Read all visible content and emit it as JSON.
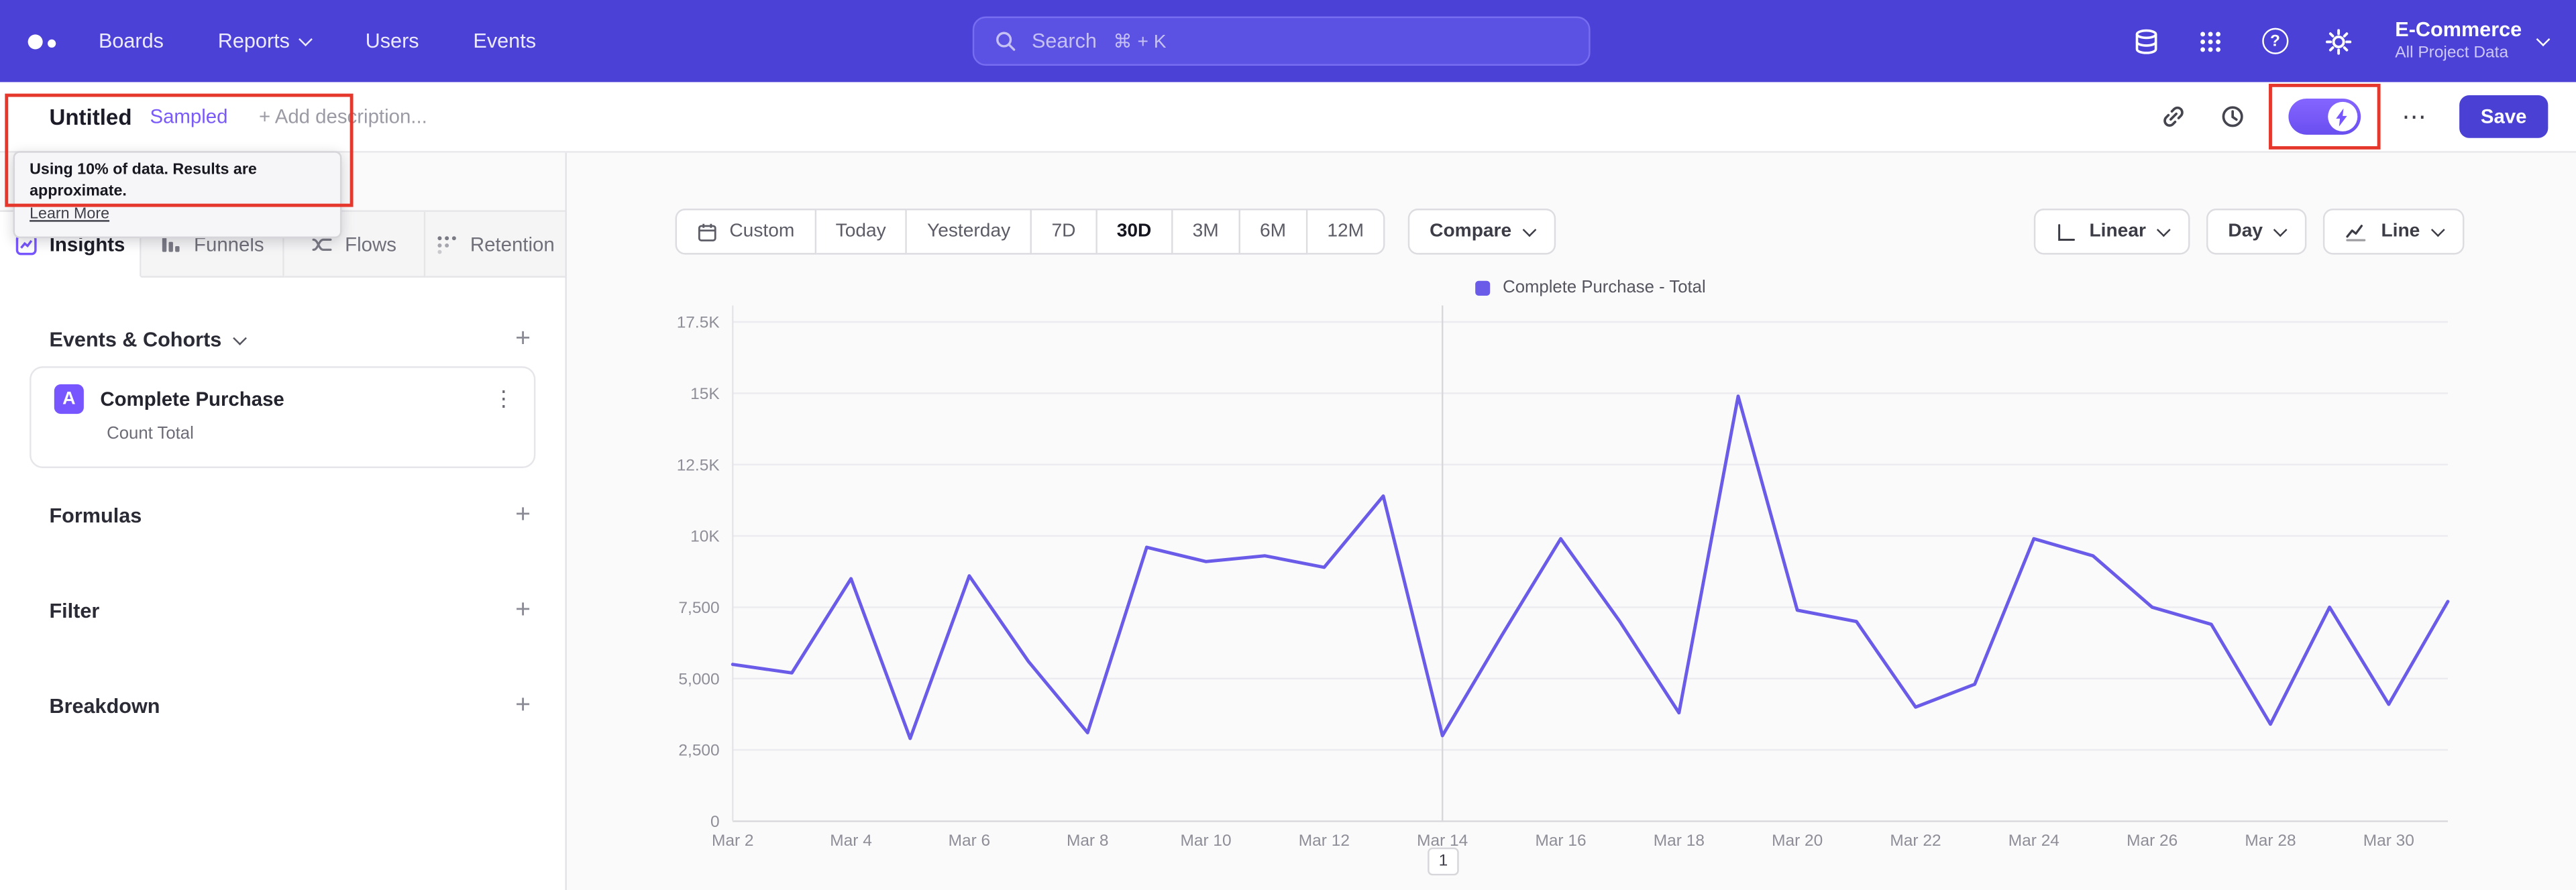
{
  "topnav": {
    "nav_items": [
      {
        "label": "Boards"
      },
      {
        "label": "Reports"
      },
      {
        "label": "Users"
      },
      {
        "label": "Events"
      }
    ],
    "search": {
      "label": "Search",
      "shortcut": "⌘ + K"
    },
    "org": {
      "name": "E-Commerce",
      "project": "All Project Data"
    }
  },
  "report_header": {
    "title": "Untitled",
    "badge": "Sampled",
    "description_placeholder": "+ Add description...",
    "save_label": "Save",
    "tooltip": {
      "text": "Using 10% of data. Results are approximate.",
      "link": "Learn More"
    }
  },
  "icons": {
    "more": "⋯",
    "kebab": "⋮",
    "plus": "+",
    "question": "?"
  },
  "sidebar": {
    "tabs": [
      {
        "label": "Insights",
        "active": true
      },
      {
        "label": "Funnels",
        "active": false
      },
      {
        "label": "Flows",
        "active": false
      },
      {
        "label": "Retention",
        "active": false
      }
    ],
    "events_section_label": "Events & Cohorts",
    "event_card": {
      "badge": "A",
      "title": "Complete Purchase",
      "subtitle": "Count Total"
    },
    "formulas_label": "Formulas",
    "filter_label": "Filter",
    "breakdown_label": "Breakdown"
  },
  "controls": {
    "date_ranges": [
      "Custom",
      "Today",
      "Yesterday",
      "7D",
      "30D",
      "3M",
      "6M",
      "12M"
    ],
    "active_range": "30D",
    "compare_label": "Compare",
    "scale_label": "Linear",
    "interval_label": "Day",
    "chart_type_label": "Line"
  },
  "pagination": {
    "page": "1"
  },
  "chart_data": {
    "type": "line",
    "title": "Complete Purchase - Total (30D daily counts)",
    "x": [
      "Mar 2",
      "Mar 3",
      "Mar 4",
      "Mar 5",
      "Mar 6",
      "Mar 7",
      "Mar 8",
      "Mar 9",
      "Mar 10",
      "Mar 11",
      "Mar 12",
      "Mar 13",
      "Mar 14",
      "Mar 15",
      "Mar 16",
      "Mar 17",
      "Mar 18",
      "Mar 19",
      "Mar 20",
      "Mar 21",
      "Mar 22",
      "Mar 23",
      "Mar 24",
      "Mar 25",
      "Mar 26",
      "Mar 27",
      "Mar 28",
      "Mar 29",
      "Mar 30",
      "Mar 31"
    ],
    "series": [
      {
        "name": "Complete Purchase - Total",
        "values": [
          5500,
          5200,
          8500,
          2900,
          8600,
          5600,
          3100,
          9600,
          9100,
          9300,
          8900,
          11400,
          3000,
          6500,
          9900,
          7000,
          3800,
          14900,
          7400,
          7000,
          4000,
          4800,
          9900,
          9300,
          7500,
          6900,
          3400,
          7500,
          4100,
          7700
        ]
      }
    ],
    "ylim": [
      0,
      17500
    ],
    "yticks": [
      {
        "value": 0,
        "label": "0"
      },
      {
        "value": 2500,
        "label": "2,500"
      },
      {
        "value": 5000,
        "label": "5,000"
      },
      {
        "value": 7500,
        "label": "7,500"
      },
      {
        "value": 10000,
        "label": "10K"
      },
      {
        "value": 12500,
        "label": "12.5K"
      },
      {
        "value": 15000,
        "label": "15K"
      },
      {
        "value": 17500,
        "label": "17.5K"
      }
    ],
    "x_label_every": 2,
    "marker_index": 12,
    "grid": true,
    "legend_position": "top",
    "line_color": "#6a5be8",
    "legend": [
      {
        "label": "Complete Purchase - Total",
        "color": "#6a5be8"
      }
    ]
  },
  "colors": {
    "nav_background": "#4b41d6",
    "accent_purple": "#7856FF",
    "line_color": "#6a5be8",
    "annotation_red": "#e5372b",
    "save_button": "#4a40d4"
  }
}
